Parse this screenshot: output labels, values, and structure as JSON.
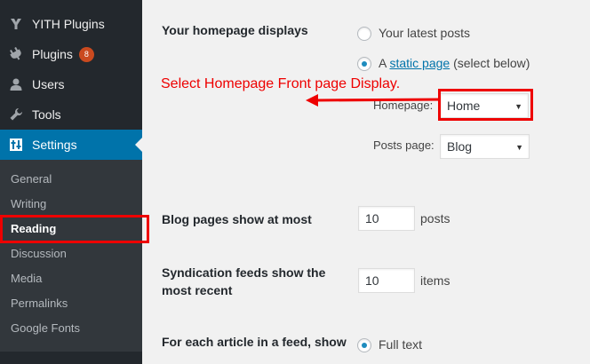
{
  "sidebar": {
    "menu": [
      {
        "label": "YITH Plugins",
        "icon": "yith-icon"
      },
      {
        "label": "Plugins",
        "icon": "plugin-icon",
        "badge": "8"
      },
      {
        "label": "Users",
        "icon": "user-icon"
      },
      {
        "label": "Tools",
        "icon": "wrench-icon"
      },
      {
        "label": "Settings",
        "icon": "settings-icon",
        "current": true
      }
    ],
    "submenu": [
      {
        "label": "General"
      },
      {
        "label": "Writing"
      },
      {
        "label": "Reading",
        "current": true
      },
      {
        "label": "Discussion"
      },
      {
        "label": "Media"
      },
      {
        "label": "Permalinks"
      },
      {
        "label": "Google Fonts"
      }
    ]
  },
  "reading": {
    "homepage_displays": {
      "label": "Your homepage displays",
      "option_latest": "Your latest posts",
      "option_static_prefix": "A",
      "option_static_link": "static page",
      "option_static_suffix": "(select below)",
      "selected": "static"
    },
    "homepage_select": {
      "label": "Homepage:",
      "value": "Home"
    },
    "posts_page_select": {
      "label": "Posts page:",
      "value": "Blog"
    },
    "blog_pages": {
      "label": "Blog pages show at most",
      "value": "10",
      "unit": "posts"
    },
    "syndication": {
      "label_line1": "Syndication feeds show the",
      "label_line2": "most recent",
      "value": "10",
      "unit": "items"
    },
    "feed_article": {
      "label": "For each article in a feed, show",
      "option_full": "Full text"
    }
  },
  "annotation": {
    "text": "Select Homepage Front page Display.",
    "color": "#e00000"
  },
  "colors": {
    "sidebar_bg": "#23282d",
    "submenu_bg": "#32373c",
    "accent": "#0073aa",
    "badge": "#ca4a1f",
    "highlight": "#e00000"
  }
}
